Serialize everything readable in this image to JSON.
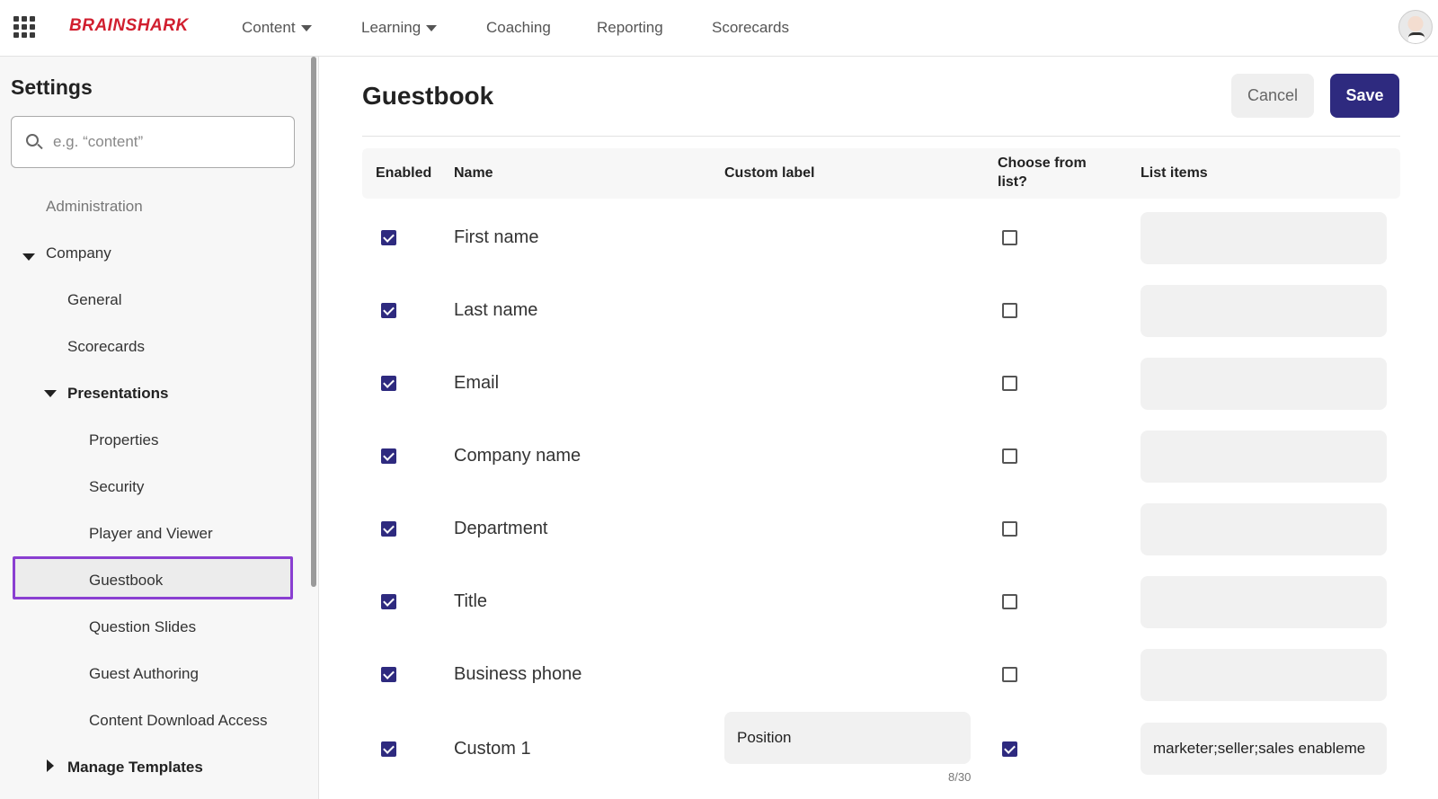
{
  "app": {
    "logo": "BRAINSHARK"
  },
  "nav": {
    "content": "Content",
    "learning": "Learning",
    "coaching": "Coaching",
    "reporting": "Reporting",
    "scorecards": "Scorecards"
  },
  "sidebar": {
    "title": "Settings",
    "search_placeholder": "e.g. “content”",
    "items": {
      "administration": "Administration",
      "company": "Company",
      "general": "General",
      "scorecards": "Scorecards",
      "presentations": "Presentations",
      "properties": "Properties",
      "security": "Security",
      "player_viewer": "Player and Viewer",
      "guestbook": "Guestbook",
      "question_slides": "Question Slides",
      "guest_authoring": "Guest Authoring",
      "content_download": "Content Download Access",
      "manage_templates": "Manage Templates"
    }
  },
  "main": {
    "title": "Guestbook",
    "cancel_label": "Cancel",
    "save_label": "Save",
    "columns": {
      "enabled": "Enabled",
      "name": "Name",
      "custom_label": "Custom label",
      "choose_line1": "Choose from",
      "choose_line2": "list?",
      "list_items": "List items"
    },
    "rows": [
      {
        "name": "First name",
        "enabled": true,
        "choose": false,
        "custom_label": "",
        "list_items": ""
      },
      {
        "name": "Last name",
        "enabled": true,
        "choose": false,
        "custom_label": "",
        "list_items": ""
      },
      {
        "name": "Email",
        "enabled": true,
        "choose": false,
        "custom_label": "",
        "list_items": ""
      },
      {
        "name": "Company name",
        "enabled": true,
        "choose": false,
        "custom_label": "",
        "list_items": ""
      },
      {
        "name": "Department",
        "enabled": true,
        "choose": false,
        "custom_label": "",
        "list_items": ""
      },
      {
        "name": "Title",
        "enabled": true,
        "choose": false,
        "custom_label": "",
        "list_items": ""
      },
      {
        "name": "Business phone",
        "enabled": true,
        "choose": false,
        "custom_label": "",
        "list_items": ""
      },
      {
        "name": "Custom 1",
        "enabled": true,
        "choose": true,
        "custom_label": "Position",
        "label_counter": "8/30",
        "list_items": "marketer;seller;sales enableme"
      }
    ]
  },
  "colors": {
    "accent": "#2e2a7f",
    "logo": "#d11f2f",
    "selected_outline": "#8a3fd1"
  }
}
